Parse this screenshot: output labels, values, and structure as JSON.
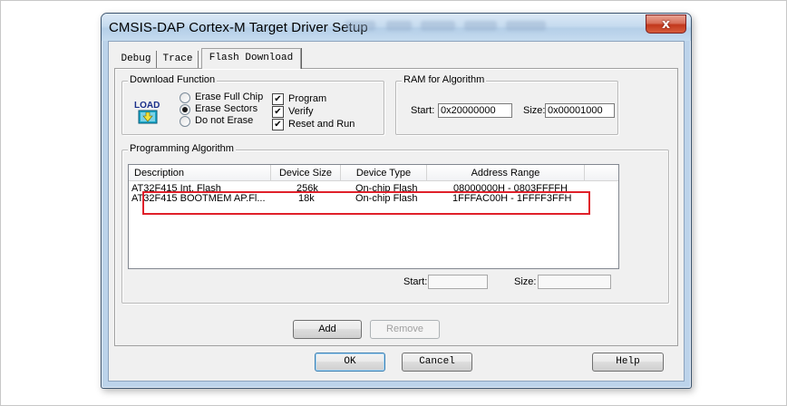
{
  "window": {
    "title": "CMSIS-DAP Cortex-M Target Driver Setup",
    "close_label": "x"
  },
  "tabs": [
    {
      "label": "Debug",
      "active": false
    },
    {
      "label": "Trace",
      "active": false
    },
    {
      "label": "Flash Download",
      "active": true
    }
  ],
  "download_function": {
    "title": "Download Function",
    "icon_text": "LOAD",
    "radios": [
      {
        "label": "Erase Full Chip",
        "checked": false
      },
      {
        "label": "Erase Sectors",
        "checked": true
      },
      {
        "label": "Do not Erase",
        "checked": false
      }
    ],
    "checkboxes": [
      {
        "label": "Program",
        "checked": true
      },
      {
        "label": "Verify",
        "checked": true
      },
      {
        "label": "Reset and Run",
        "checked": true
      }
    ]
  },
  "ram": {
    "title": "RAM for Algorithm",
    "start_label": "Start:",
    "start_value": "0x20000000",
    "size_label": "Size:",
    "size_value": "0x00001000"
  },
  "programming": {
    "title": "Programming Algorithm",
    "columns": [
      "Description",
      "Device Size",
      "Device Type",
      "Address Range"
    ],
    "rows": [
      {
        "description": "AT32F415 Int. Flash",
        "size": "256k",
        "type": "On-chip Flash",
        "range": "08000000H - 0803FFFFH"
      },
      {
        "description": "AT32F415 BOOTMEM AP.Fl...",
        "size": "18k",
        "type": "On-chip Flash",
        "range": "1FFFAC00H - 1FFFF3FFH"
      }
    ],
    "start_label": "Start:",
    "start_value": "",
    "size_label": "Size:",
    "size_value": ""
  },
  "buttons": {
    "add": "Add",
    "remove": "Remove",
    "ok": "OK",
    "cancel": "Cancel",
    "help": "Help"
  },
  "colors": {
    "highlight": "#e0202a",
    "title_bar": "#c6dbef",
    "close_button": "#c2381c"
  }
}
